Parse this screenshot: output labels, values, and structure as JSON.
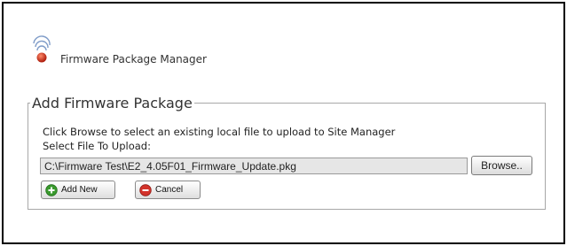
{
  "app": {
    "title": "Firmware Package Manager"
  },
  "section": {
    "legend": "Add Firmware Package",
    "instruction_line1": "Click Browse to select an existing local file to upload to Site Manager",
    "instruction_line2": "Select File To Upload:"
  },
  "file": {
    "path": "C:\\Firmware Test\\E2_4.05F01_Firmware_Update.pkg"
  },
  "buttons": {
    "browse": "Browse..",
    "add_new": "Add New",
    "cancel": "Cancel"
  },
  "icons": {
    "logo": "wireless-signal-icon",
    "add": "plus-circle-icon",
    "cancel": "minus-circle-icon"
  },
  "colors": {
    "logo_red": "#d9341f",
    "add_green": "#3a9a2e",
    "cancel_red": "#d3332b"
  }
}
